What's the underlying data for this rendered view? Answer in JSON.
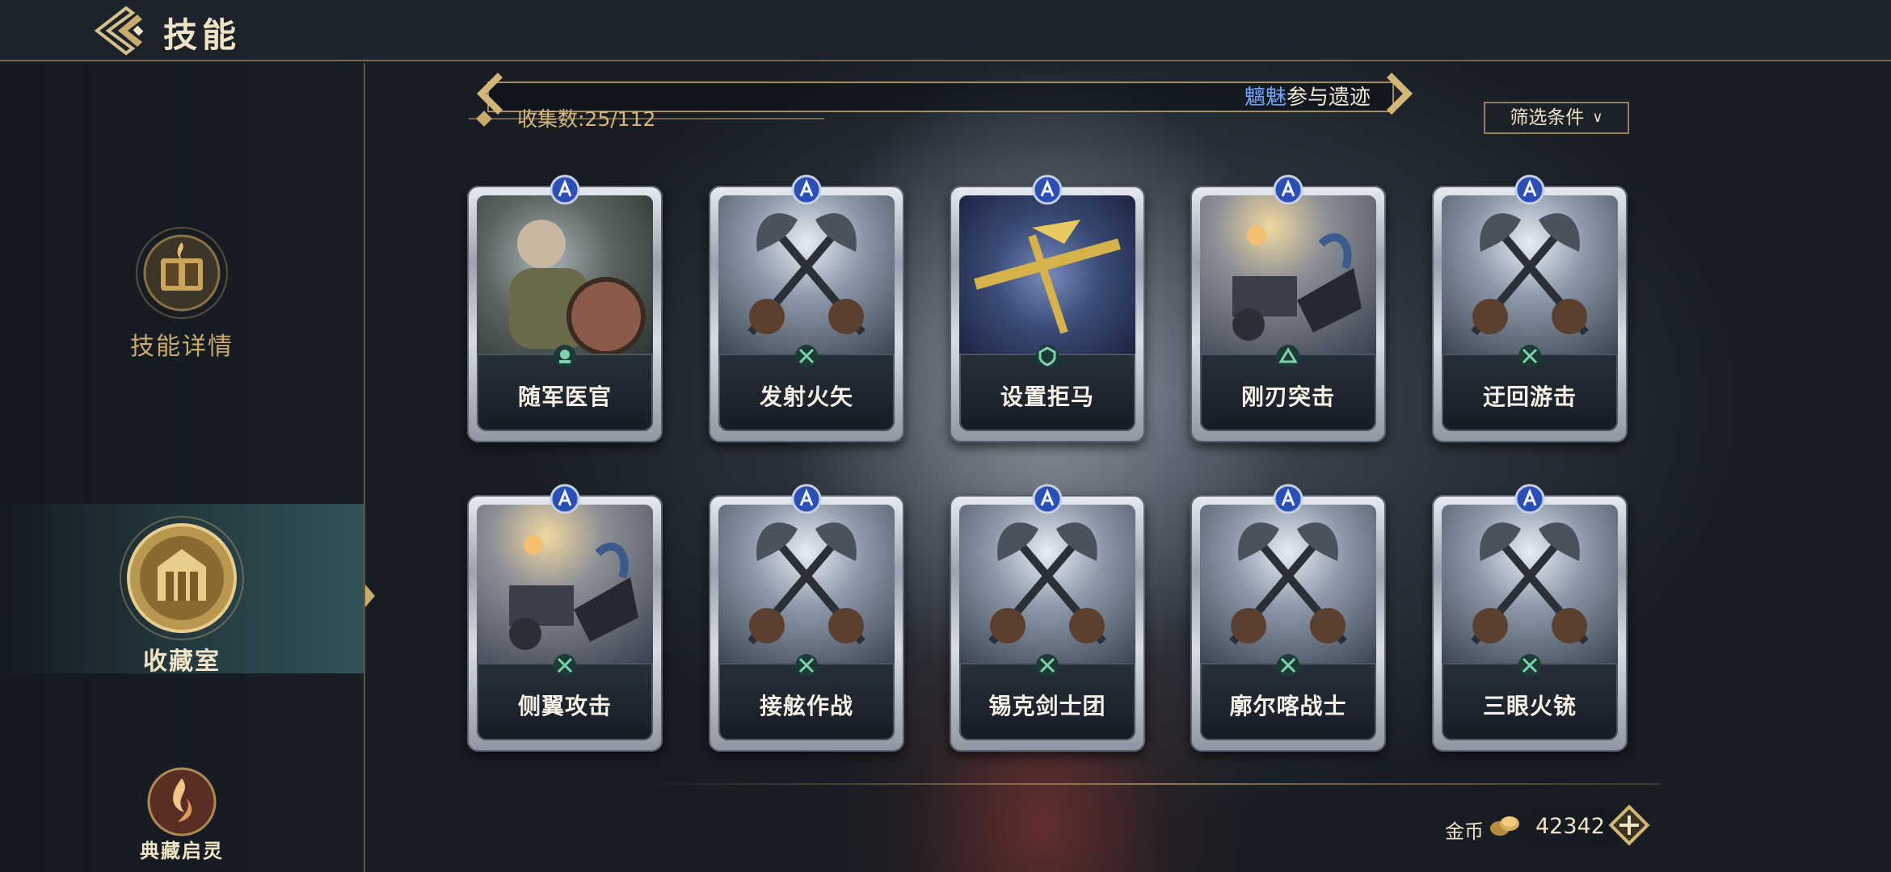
{
  "header": {
    "title": "技能"
  },
  "nav": {
    "items": [
      {
        "label": "技能详情",
        "icon": "skill-book-icon"
      },
      {
        "label": "收藏室",
        "icon": "collection-hall-icon",
        "active": true
      },
      {
        "label": "典藏启灵",
        "icon": "flame-icon"
      }
    ]
  },
  "collection": {
    "count_text": "收集数:25/112",
    "ticker_name": "魑魅",
    "ticker_text": "参与遗迹"
  },
  "filter": {
    "label": "筛选条件"
  },
  "cards": [
    {
      "name": "随军医官",
      "art": "medic",
      "type_icon": "support-icon"
    },
    {
      "name": "发射火矢",
      "art": "axes",
      "type_icon": "crossed-weapons-icon"
    },
    {
      "name": "设置拒马",
      "art": "barrier",
      "type_icon": "defense-icon"
    },
    {
      "name": "刚刃突击",
      "art": "chariot",
      "type_icon": "cavalry-icon"
    },
    {
      "name": "迂回游击",
      "art": "axes",
      "type_icon": "crossed-weapons-icon"
    },
    {
      "name": "侧翼攻击",
      "art": "chariot",
      "type_icon": "crossed-weapons-icon"
    },
    {
      "name": "接舷作战",
      "art": "axes",
      "type_icon": "crossed-weapons-icon"
    },
    {
      "name": "锡克剑士团",
      "art": "axes",
      "type_icon": "crossed-weapons-icon"
    },
    {
      "name": "廓尔喀战士",
      "art": "axes",
      "type_icon": "crossed-weapons-icon"
    },
    {
      "name": "三眼火铳",
      "art": "axes",
      "type_icon": "crossed-weapons-icon"
    }
  ],
  "currency": {
    "label": "金币",
    "value": "42342"
  },
  "colors": {
    "accent_gold": "#c9ac6b",
    "rank_blue": "#2b4fb8",
    "name_text": "#f4f0e6"
  }
}
